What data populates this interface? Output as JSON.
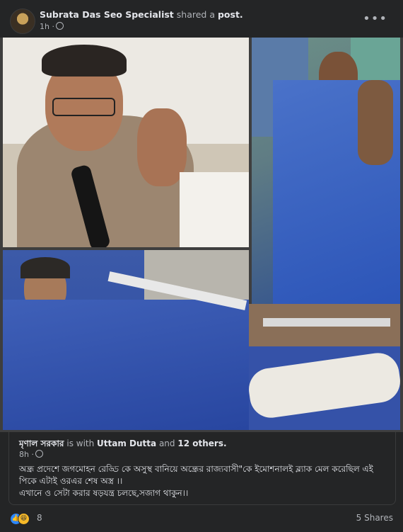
{
  "post": {
    "author": "Subrata Das Seo Specialist",
    "action": "shared a",
    "object": "post.",
    "time": "1h ·",
    "more_icon": "more-horizontal-icon"
  },
  "shared_post": {
    "author": "মৃণাল সরকার",
    "with_text": "is with",
    "with_person": "Uttam Dutta",
    "and_text": "and",
    "others": "12 others.",
    "time": "8h ·",
    "text_line1": "অন্ধ্র প্রদেশে জগমোহন রেড্ডি কে অসুস্থ বানিয়ে অন্ধ্রের রাজ্যবাসী\"কে ইমোশনালই ব্ল্যাক মেল করেছিল এই পিকে এটাই ওরএর শেষ অস্ত্র ।।",
    "text_line2": "এখানে ও সেটা করার ষড়যন্ত্র চলছে,সজাগ থাকুন।।"
  },
  "engagement": {
    "reaction_count": "8",
    "reactions": [
      "like",
      "haha"
    ],
    "shares": "5 Shares"
  },
  "colors": {
    "background": "#242526",
    "text_primary": "#e4e6eb",
    "text_secondary": "#b0b3b8",
    "like_blue": "#2d88ff",
    "haha_yellow": "#f7b928"
  }
}
